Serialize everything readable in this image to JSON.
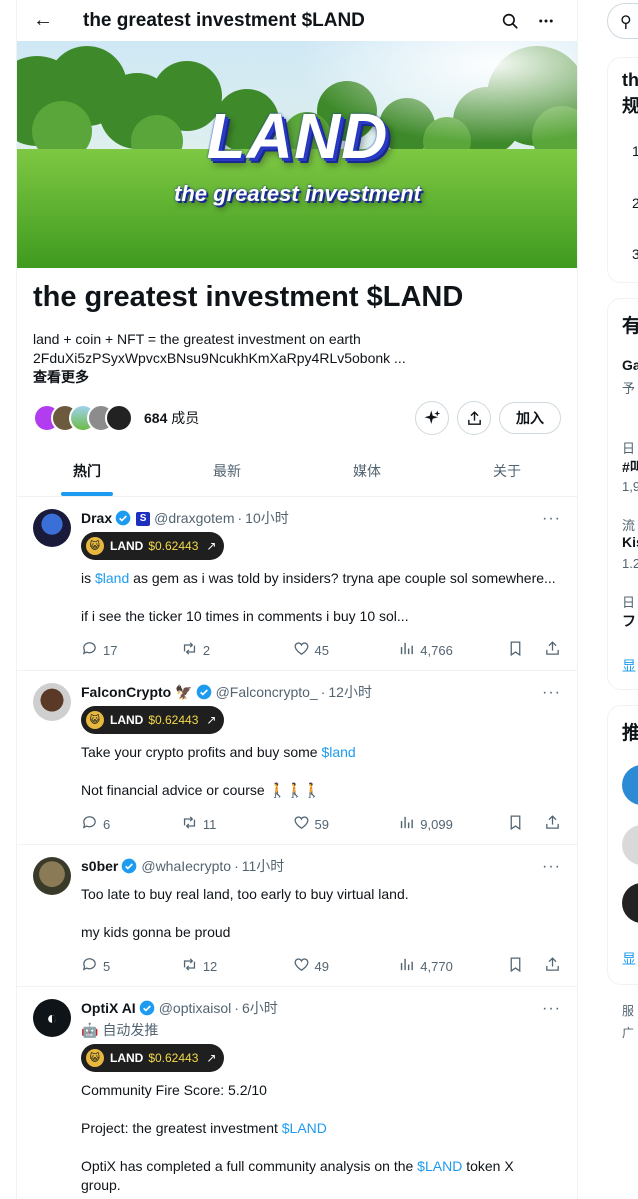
{
  "header": {
    "title": "the greatest investment $LAND"
  },
  "banner": {
    "logo": "LAND",
    "tagline": "the greatest investment"
  },
  "community": {
    "name": "the greatest investment $LAND",
    "description_line1": "land + coin + NFT = the greatest investment on earth",
    "description_line2": "2FduXi5zPSyxWpvcxBNsu9NcukhKmXaRpy4RLv5obonk ...",
    "show_more": "查看更多",
    "member_count": "684",
    "member_label": "成员",
    "join_label": "加入"
  },
  "tabs": [
    "热门",
    "最新",
    "媒体",
    "关于"
  ],
  "posts": [
    {
      "name": "Drax",
      "handle": "@draxgotem",
      "time": "10小时",
      "token": {
        "symbol": "LAND",
        "price": "$0.62443"
      },
      "lines": [
        [
          {
            "t": "is "
          },
          {
            "t": "$land",
            "link": true
          },
          {
            "t": " as gem as i was told by insiders? tryna ape couple sol somewhere..."
          }
        ],
        [],
        [
          {
            "t": "if i see the ticker 10 times in comments i buy 10 sol..."
          }
        ]
      ],
      "replies": "17",
      "reposts": "2",
      "likes": "45",
      "views": "4,766"
    },
    {
      "name": "FalconCrypto 🦅",
      "handle": "@Falconcrypto_",
      "time": "12小时",
      "token": {
        "symbol": "LAND",
        "price": "$0.62443"
      },
      "lines": [
        [
          {
            "t": "Take your crypto profits and buy some "
          },
          {
            "t": "$land",
            "link": true
          }
        ],
        [],
        [
          {
            "t": "Not financial advice or course 🚶🚶🚶"
          }
        ]
      ],
      "replies": "6",
      "reposts": "11",
      "likes": "59",
      "views": "9,099"
    },
    {
      "name": "s0ber",
      "handle": "@whaIecrypto",
      "time": "11小时",
      "lines": [
        [
          {
            "t": "Too late to buy real land, too early to buy virtual land."
          }
        ],
        [],
        [
          {
            "t": "my kids gonna be proud"
          }
        ]
      ],
      "replies": "5",
      "reposts": "12",
      "likes": "49",
      "views": "4,770"
    },
    {
      "name": "OptiX AI",
      "handle": "@optixaisol",
      "time": "6小时",
      "auto_label": "自动发推",
      "token": {
        "symbol": "LAND",
        "price": "$0.62443"
      },
      "lines": [
        [
          {
            "t": "Community Fire Score: 5.2/10"
          }
        ],
        [],
        [
          {
            "t": "Project: the greatest investment "
          },
          {
            "t": "$LAND",
            "link": true
          }
        ],
        [],
        [
          {
            "t": "OptiX has completed a full community analysis on the "
          },
          {
            "t": "$LAND",
            "link": true
          },
          {
            "t": " token X"
          }
        ],
        [
          {
            "t": "group."
          }
        ]
      ]
    }
  ],
  "sidebar_fragments": [
    "th",
    "规",
    "1",
    "2",
    "3",
    "有",
    "Ga",
    "予",
    "日",
    "#叫",
    "1,9",
    "流",
    "Kis",
    "1.2",
    "日",
    "フ",
    "显",
    "推",
    "显",
    "服",
    "广"
  ],
  "colors": {
    "accent": "#1d9bf0",
    "text": "#0f1419",
    "muted": "#536471",
    "border": "#eff3f4"
  }
}
